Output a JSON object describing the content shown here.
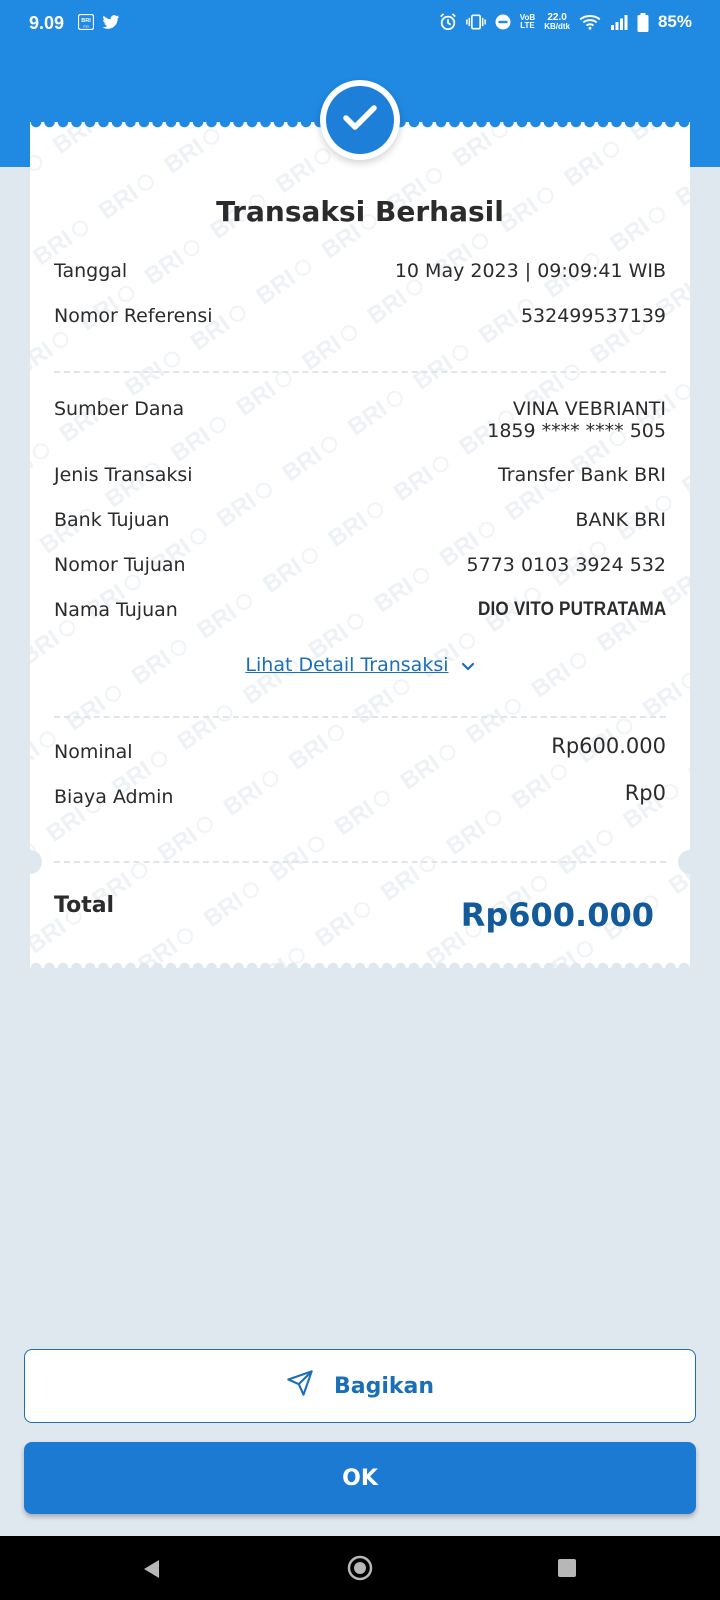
{
  "status_bar": {
    "time": "9.09",
    "network_speed": "22.0",
    "network_speed_unit": "KB/dtk",
    "volte": "VoB",
    "lte": "LTE",
    "battery": "85%",
    "icons": [
      "bri-app-icon",
      "twitter-icon",
      "alarm-icon",
      "vibrate-icon",
      "dnd-icon",
      "wifi-icon",
      "signal-icon",
      "battery-icon"
    ]
  },
  "receipt": {
    "title": "Transaksi Berhasil",
    "tanggal_label": "Tanggal",
    "tanggal_value": "10 May 2023 | 09:09:41 WIB",
    "ref_label": "Nomor Referensi",
    "ref_value": "532499537139",
    "sumber_label": "Sumber Dana",
    "sumber_name": "VINA VEBRIANTI",
    "sumber_account": "1859 **** **** 505",
    "jenis_label": "Jenis Transaksi",
    "jenis_value": "Transfer Bank BRI",
    "bank_label": "Bank Tujuan",
    "bank_value": "BANK BRI",
    "nomor_tujuan_label": "Nomor Tujuan",
    "nomor_tujuan_value": "5773 0103 3924 532",
    "nama_tujuan_label": "Nama Tujuan",
    "nama_tujuan_value": "DIO VITO PUTRATAMA",
    "detail_link": "Lihat Detail Transaksi",
    "nominal_label": "Nominal",
    "nominal_value": "Rp600.000",
    "admin_label": "Biaya Admin",
    "admin_value": "Rp0",
    "total_label": "Total",
    "total_value": "Rp600.000"
  },
  "actions": {
    "share_label": "Bagikan",
    "ok_label": "OK"
  },
  "colors": {
    "header_blue": "#2089e2",
    "primary": "#1d7ad3",
    "total_text": "#125a9a",
    "background": "#dfe7ef"
  }
}
